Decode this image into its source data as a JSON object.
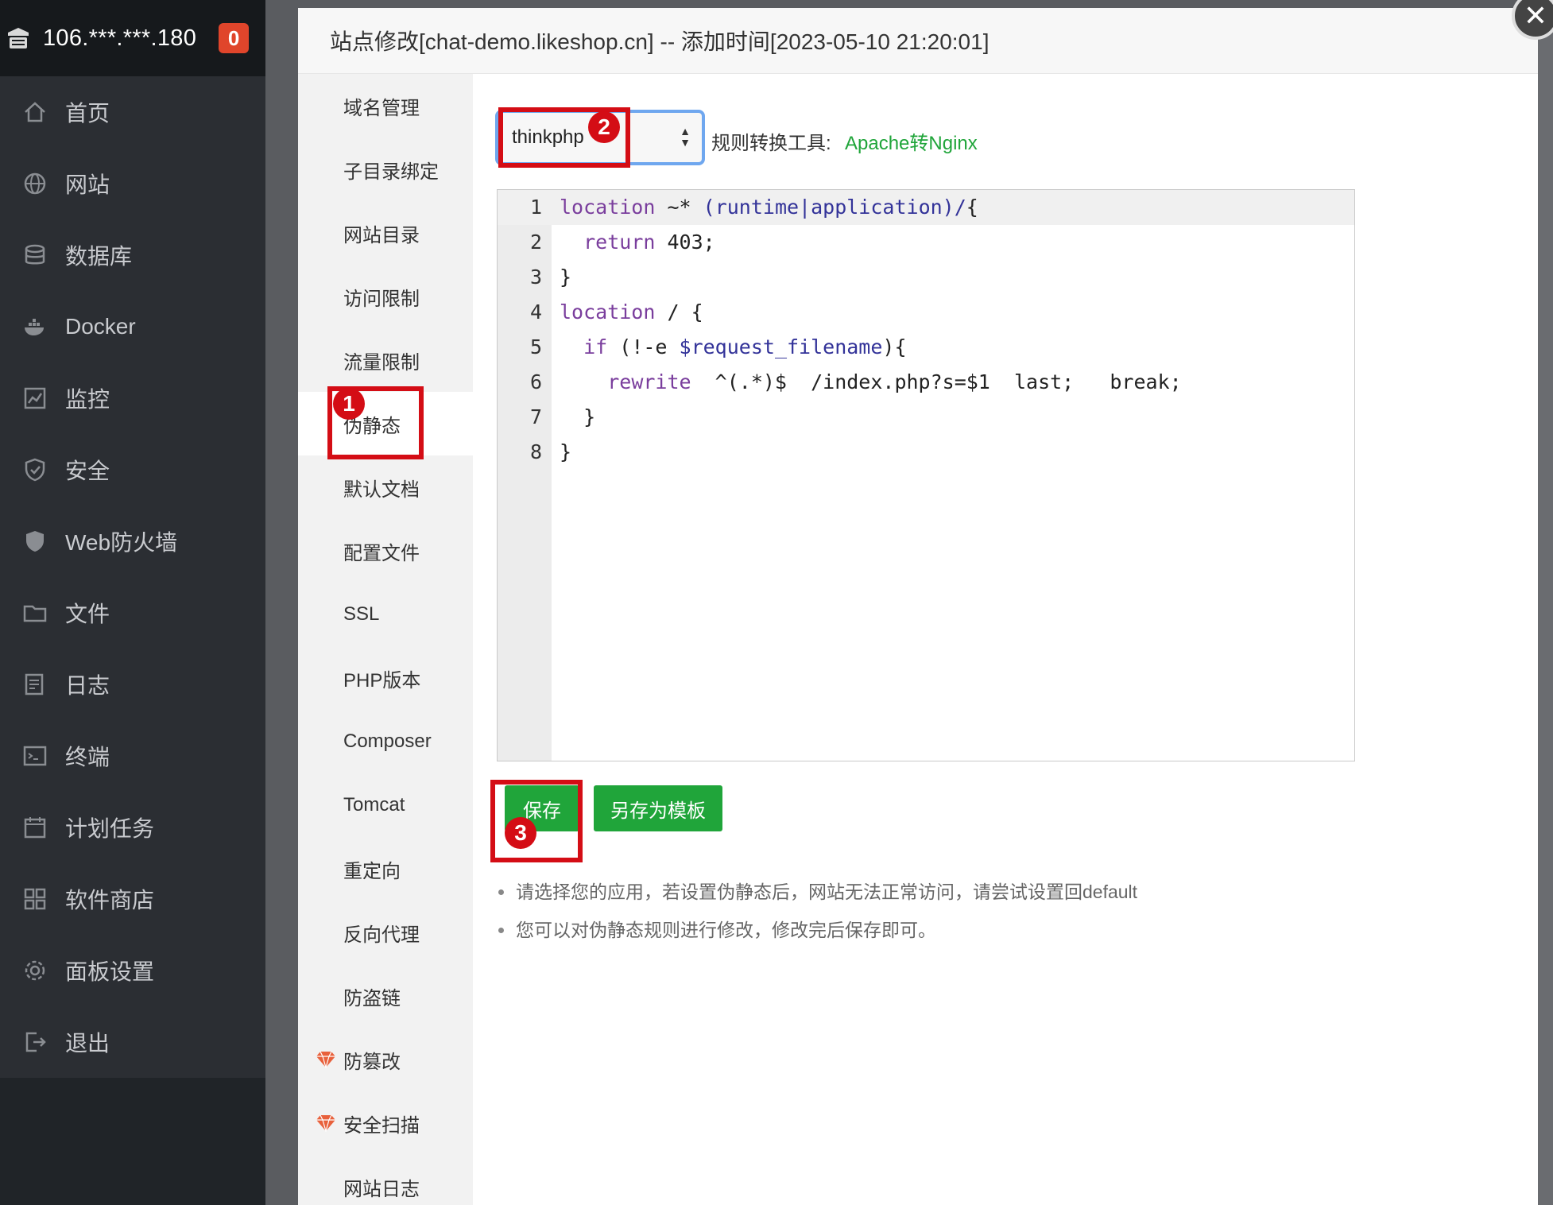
{
  "sidebar": {
    "ip": "106.***.***.180",
    "badge": "0",
    "items": [
      {
        "label": "首页",
        "icon": "home-icon"
      },
      {
        "label": "网站",
        "icon": "globe-icon"
      },
      {
        "label": "数据库",
        "icon": "database-icon"
      },
      {
        "label": "Docker",
        "icon": "docker-icon"
      },
      {
        "label": "监控",
        "icon": "monitor-icon"
      },
      {
        "label": "安全",
        "icon": "shield-icon"
      },
      {
        "label": "Web防火墙",
        "icon": "firewall-icon"
      },
      {
        "label": "文件",
        "icon": "folder-icon"
      },
      {
        "label": "日志",
        "icon": "log-icon"
      },
      {
        "label": "终端",
        "icon": "terminal-icon"
      },
      {
        "label": "计划任务",
        "icon": "calendar-icon"
      },
      {
        "label": "软件商店",
        "icon": "apps-icon"
      },
      {
        "label": "面板设置",
        "icon": "gear-icon"
      },
      {
        "label": "退出",
        "icon": "logout-icon"
      }
    ]
  },
  "modal": {
    "title": "站点修改[chat-demo.likeshop.cn] -- 添加时间[2023-05-10 21:20:01]",
    "close": "✕",
    "tabs": [
      {
        "label": "域名管理"
      },
      {
        "label": "子目录绑定"
      },
      {
        "label": "网站目录"
      },
      {
        "label": "访问限制"
      },
      {
        "label": "流量限制"
      },
      {
        "label": "伪静态"
      },
      {
        "label": "默认文档"
      },
      {
        "label": "配置文件"
      },
      {
        "label": "SSL"
      },
      {
        "label": "PHP版本"
      },
      {
        "label": "Composer"
      },
      {
        "label": "Tomcat"
      },
      {
        "label": "重定向"
      },
      {
        "label": "反向代理"
      },
      {
        "label": "防盗链"
      },
      {
        "label": "防篡改"
      },
      {
        "label": "安全扫描"
      },
      {
        "label": "网站日志"
      }
    ],
    "active_tab": "伪静态"
  },
  "rewrite": {
    "selected": "thinkphp",
    "tool_label": "规则转换工具:",
    "tool_link": "Apache转Nginx",
    "code_lines": [
      {
        "n": "1",
        "text": "location ~* (runtime|application)/{"
      },
      {
        "n": "2",
        "text": "  return 403;"
      },
      {
        "n": "3",
        "text": "}"
      },
      {
        "n": "4",
        "text": "location / {"
      },
      {
        "n": "5",
        "text": "  if (!-e $request_filename){"
      },
      {
        "n": "6",
        "text": "    rewrite  ^(.*)$  /index.php?s=$1  last;   break;"
      },
      {
        "n": "7",
        "text": "  }"
      },
      {
        "n": "8",
        "text": "}"
      }
    ],
    "save_label": "保存",
    "save_template_label": "另存为模板",
    "notes": [
      "请选择您的应用，若设置伪静态后，网站无法正常访问，请尝试设置回default",
      "您可以对伪静态规则进行修改，修改完后保存即可。"
    ]
  },
  "annotations": {
    "step1": "1",
    "step2": "2",
    "step3": "3"
  },
  "colors": {
    "accent_green": "#20a53a",
    "annotation_red": "#d40d15",
    "sidebar_bg": "#2b2e33"
  }
}
